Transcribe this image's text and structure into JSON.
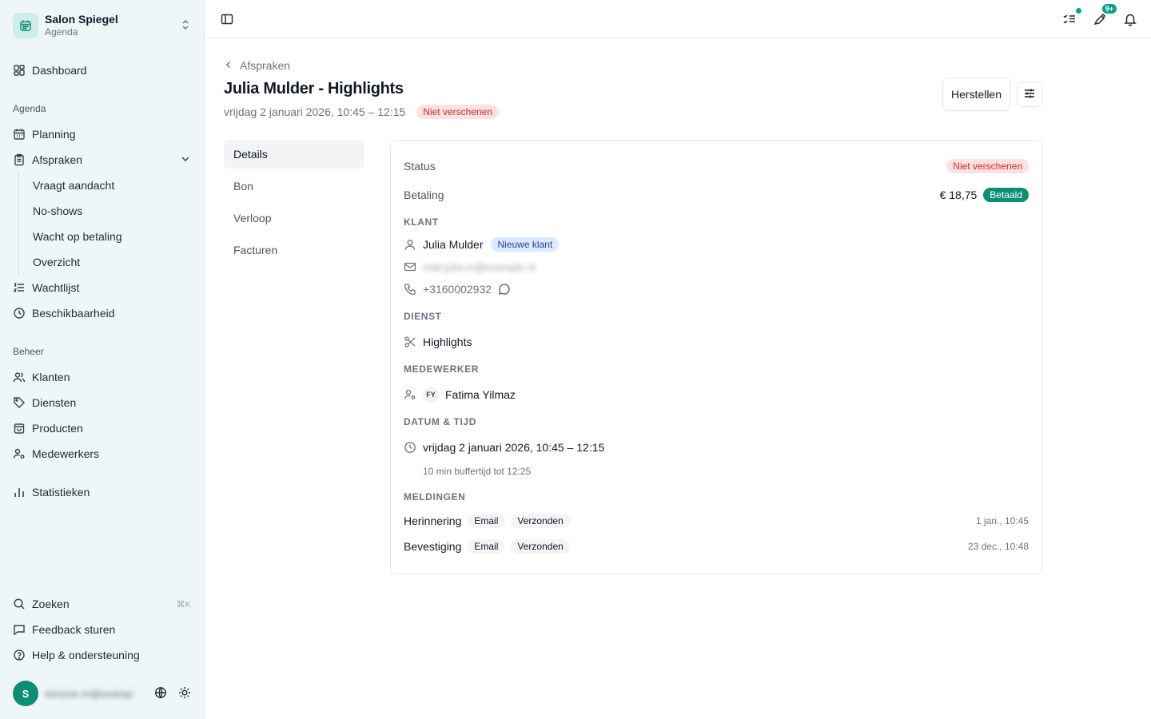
{
  "sidebar": {
    "brand_name": "Salon Spiegel",
    "brand_sub": "Agenda",
    "dashboard": "Dashboard",
    "section_agenda": "Agenda",
    "planning": "Planning",
    "afspraken": "Afspraken",
    "sub": [
      "Vraagt aandacht",
      "No-shows",
      "Wacht op betaling",
      "Overzicht"
    ],
    "wachtlijst": "Wachtlijst",
    "beschikbaarheid": "Beschikbaarheid",
    "section_beheer": "Beheer",
    "klanten": "Klanten",
    "diensten": "Diensten",
    "producten": "Producten",
    "medewerkers": "Medewerkers",
    "statistieken": "Statistieken",
    "zoeken": "Zoeken",
    "zoeken_shortcut": "⌘K",
    "feedback": "Feedback sturen",
    "help": "Help & ondersteuning",
    "user_initial": "S",
    "user_email": "simone.m@example.nl"
  },
  "topbar": {
    "tasks_badge": "",
    "messages_badge": "9+"
  },
  "page": {
    "breadcrumb": "Afspraken",
    "title": "Julia Mulder - Highlights",
    "subtitle": "vrijdag 2 januari 2026, 10:45 – 12:15",
    "status_pill": "Niet verschenen",
    "restore_button": "Herstellen"
  },
  "tabs": [
    "Details",
    "Bon",
    "Verloop",
    "Facturen"
  ],
  "details": {
    "status_label": "Status",
    "status_value": "Niet verschenen",
    "payment_label": "Betaling",
    "payment_amount": "€ 18,75",
    "payment_status": "Betaald",
    "klant_heading": "KLANT",
    "client_name": "Julia Mulder",
    "client_badge": "Nieuwe klant",
    "client_email": "mail.julia.m@example.nl",
    "client_phone": "+3160002932",
    "dienst_heading": "DIENST",
    "service": "Highlights",
    "medewerker_heading": "MEDEWERKER",
    "employee_initials": "FY",
    "employee_name": "Fatima Yilmaz",
    "datetime_heading": "DATUM & TIJD",
    "datetime": "vrijdag 2 januari 2026, 10:45 – 12:15",
    "buffer": "10 min buffertijd tot 12:25",
    "meldingen_heading": "MELDINGEN",
    "notifications": [
      {
        "type": "Herinnering",
        "channel": "Email",
        "status": "Verzonden",
        "time": "1 jan., 10:45"
      },
      {
        "type": "Bevestiging",
        "channel": "Email",
        "status": "Verzonden",
        "time": "23 dec., 10:48"
      }
    ]
  },
  "colors": {
    "accent": "#0d8f74",
    "danger": "#dc2626",
    "sidebar_bg": "#eef6f8"
  }
}
